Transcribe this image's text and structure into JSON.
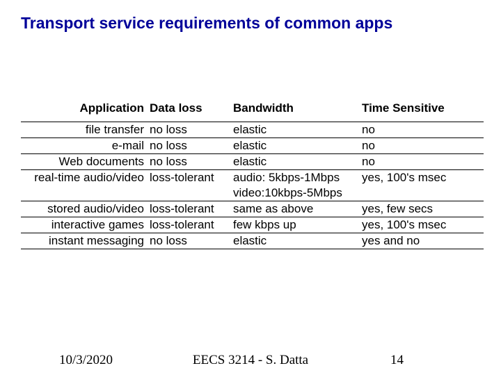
{
  "title": "Transport service requirements of common apps",
  "headers": {
    "application": "Application",
    "dataloss": "Data loss",
    "bandwidth": "Bandwidth",
    "timesensitive": "Time Sensitive"
  },
  "rows": [
    {
      "app": "file transfer",
      "loss": "no loss",
      "bw": "elastic",
      "time": "no"
    },
    {
      "app": "e-mail",
      "loss": "no loss",
      "bw": "elastic",
      "time": "no"
    },
    {
      "app": "Web documents",
      "loss": "no loss",
      "bw": "elastic",
      "time": "no"
    },
    {
      "app": "real-time audio/video",
      "loss": "loss-tolerant",
      "bw": "audio: 5kbps-1Mbps",
      "time": "yes, 100's msec"
    },
    {
      "app": "",
      "loss": "",
      "bw": "video:10kbps-5Mbps",
      "time": ""
    },
    {
      "app": "stored audio/video",
      "loss": "loss-tolerant",
      "bw": "same as above",
      "time": "yes, few secs"
    },
    {
      "app": "interactive games",
      "loss": "loss-tolerant",
      "bw": "few kbps up",
      "time": "yes, 100's msec"
    },
    {
      "app": "instant messaging",
      "loss": "no loss",
      "bw": "elastic",
      "time": "yes and no"
    }
  ],
  "footer": {
    "date": "10/3/2020",
    "course": "EECS 3214 - S. Datta",
    "page": "14"
  }
}
